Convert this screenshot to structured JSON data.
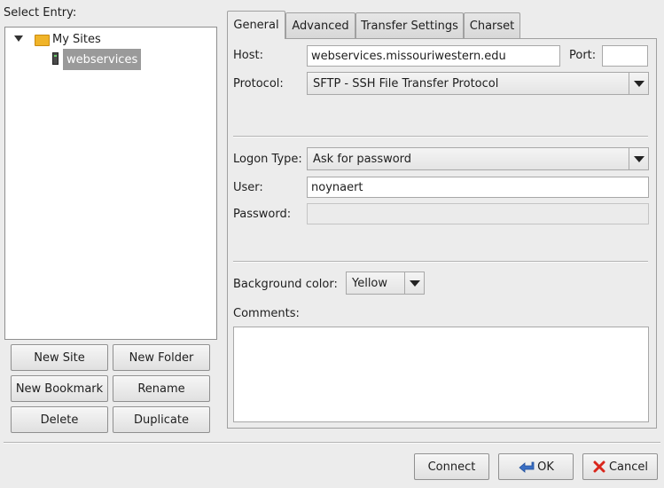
{
  "select_entry_label": "Select Entry:",
  "tree": {
    "root_label": "My Sites",
    "child_label": "webservices"
  },
  "left_buttons": {
    "new_site": "New Site",
    "new_folder": "New Folder",
    "new_bookmark": "New Bookmark",
    "rename": "Rename",
    "delete": "Delete",
    "duplicate": "Duplicate"
  },
  "tabs": [
    "General",
    "Advanced",
    "Transfer Settings",
    "Charset"
  ],
  "general": {
    "host_label": "Host:",
    "host_value": "webservices.missouriwestern.edu",
    "port_label": "Port:",
    "port_value": "",
    "protocol_label": "Protocol:",
    "protocol_value": "SFTP - SSH File Transfer Protocol",
    "logon_type_label": "Logon Type:",
    "logon_type_value": "Ask for password",
    "user_label": "User:",
    "user_value": "noynaert",
    "password_label": "Password:",
    "password_value": "",
    "bg_color_label": "Background color:",
    "bg_color_value": "Yellow",
    "comments_label": "Comments:",
    "comments_value": ""
  },
  "footer": {
    "connect": "Connect",
    "ok": "OK",
    "cancel": "Cancel"
  },
  "colors": {
    "selection": "#9a9a9a",
    "folder": "#f0b429",
    "cancel_icon": "#d9261c",
    "ok_icon": "#3a6fc4"
  }
}
